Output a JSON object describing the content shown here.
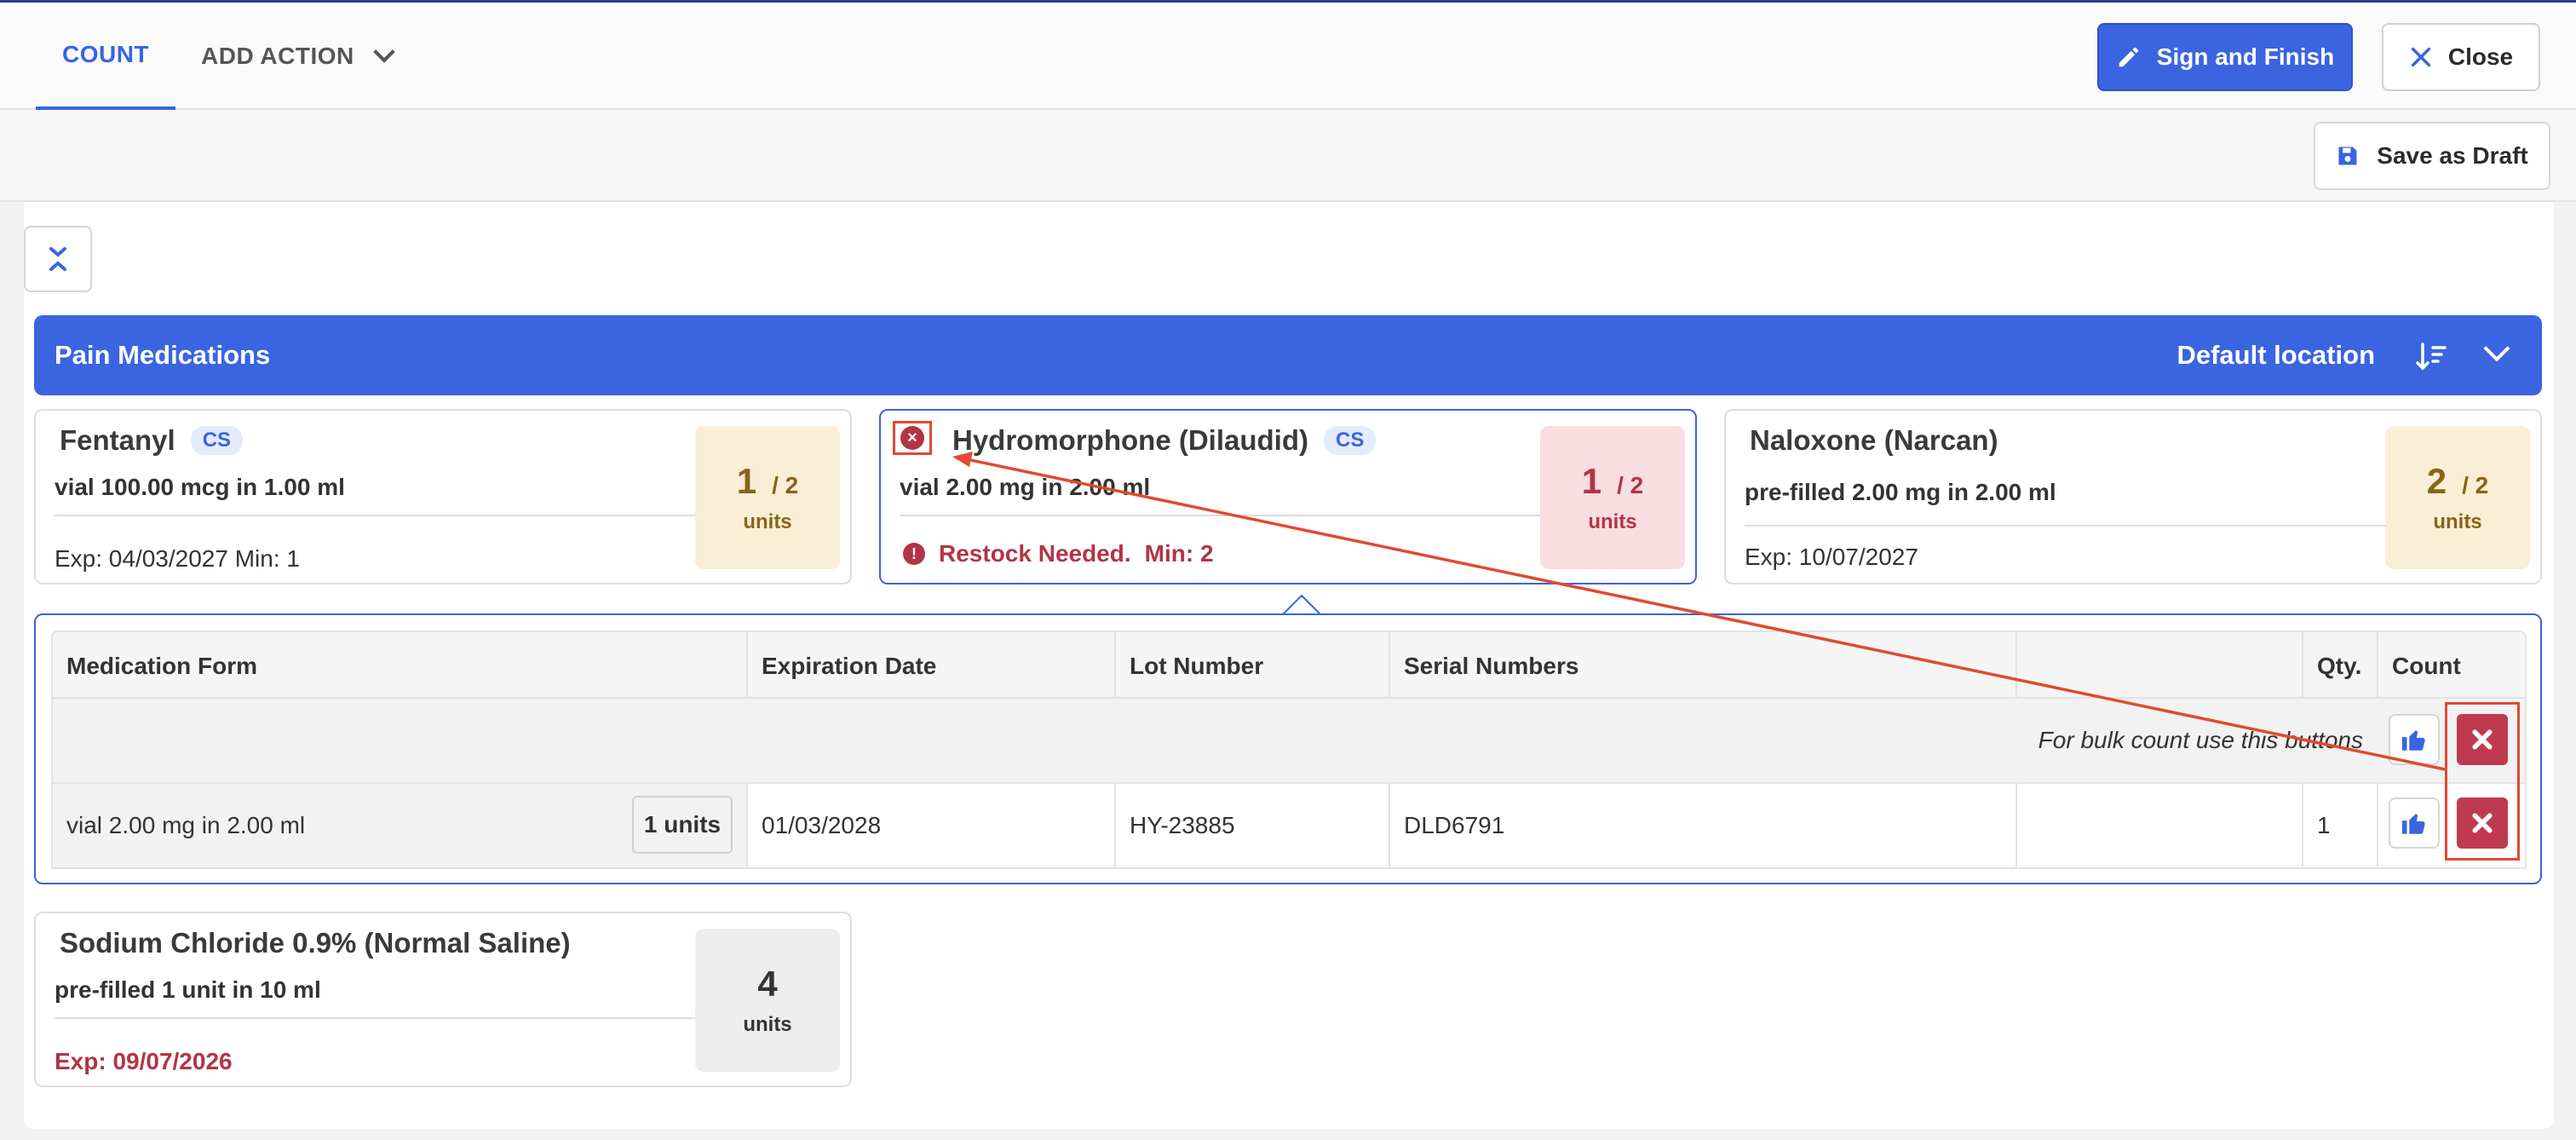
{
  "header": {
    "tabs": [
      {
        "label": "COUNT",
        "active": true
      },
      {
        "label": "ADD ACTION",
        "active": false
      }
    ],
    "sign_label": "Sign and Finish",
    "close_label": "Close",
    "draft_label": "Save as Draft"
  },
  "section": {
    "title": "Pain Medications",
    "location": "Default location"
  },
  "cards": [
    {
      "name": "Fentanyl",
      "badge": "CS",
      "desc": "vial 100.00 mcg in 1.00 ml",
      "exp": "Exp: 04/03/2027 Min: 1",
      "count": "1",
      "total": "/ 2",
      "units": "units",
      "status_color": "#fbeed6"
    },
    {
      "name": "Hydromorphone (Dilaudid)",
      "badge": "CS",
      "desc": "vial 2.00 mg in 2.00 ml",
      "restock": "Restock Needed.",
      "restock_min": "Min: 2",
      "count": "1",
      "total": "/ 2",
      "units": "units",
      "status_color": "#f8dde1"
    },
    {
      "name": "Naloxone (Narcan)",
      "desc": "pre-filled 2.00 mg in 2.00 ml",
      "exp": "Exp: 10/07/2027",
      "count": "2",
      "total": "/ 2",
      "units": "units",
      "status_color": "#fbeed6"
    },
    {
      "name": "Sodium Chloride 0.9% (Normal Saline)",
      "desc": "pre-filled 1 unit in 10 ml",
      "exp": "Exp: 09/07/2026",
      "count": "4",
      "units": "units",
      "status_color": "#ededee"
    }
  ],
  "detail": {
    "columns": [
      "Medication Form",
      "Expiration Date",
      "Lot Number",
      "Serial Numbers",
      "",
      "Qty.",
      "Count"
    ],
    "bulk_text": "For bulk count use this buttons",
    "row": {
      "form": "vial 2.00 mg in 2.00 ml",
      "units_chip": "1 units",
      "expiration": "01/03/2028",
      "lot": "HY-23885",
      "serial": "DLD6791",
      "extra": "",
      "qty": "1"
    }
  },
  "colors": {
    "accent": "#3a64e0",
    "danger": "#c03a4f",
    "annotation": "#e04a32"
  }
}
